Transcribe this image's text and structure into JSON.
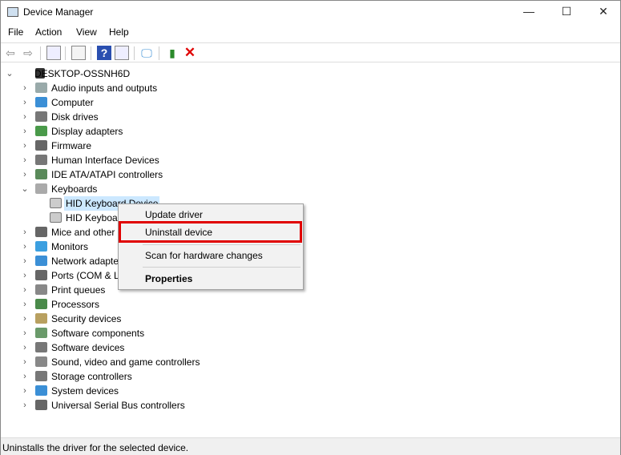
{
  "window": {
    "title": "Device Manager",
    "minimize": "—",
    "maximize": "☐",
    "close": "✕"
  },
  "menu": [
    "File",
    "Action",
    "View",
    "Help"
  ],
  "toolbar": {
    "icons": [
      "back-icon",
      "forward-icon",
      "show-hide-console-tree-icon",
      "properties-icon",
      "help-icon",
      "action-pane-icon",
      "scan-hardware-icon",
      "update-driver-icon",
      "uninstall-icon"
    ],
    "uninstall_color": "#e00000"
  },
  "tree": {
    "root": "DESKTOP-OSSNH6D",
    "items": [
      {
        "label": "Audio inputs and outputs",
        "icon": "speaker-icon",
        "color": "#9aa"
      },
      {
        "label": "Computer",
        "icon": "computer-icon",
        "color": "#3b8fd6"
      },
      {
        "label": "Disk drives",
        "icon": "disk-icon",
        "color": "#777"
      },
      {
        "label": "Display adapters",
        "icon": "display-adapter-icon",
        "color": "#4a9a4a"
      },
      {
        "label": "Firmware",
        "icon": "firmware-icon",
        "color": "#666"
      },
      {
        "label": "Human Interface Devices",
        "icon": "hid-icon",
        "color": "#777"
      },
      {
        "label": "IDE ATA/ATAPI controllers",
        "icon": "ide-icon",
        "color": "#5a8a5a"
      },
      {
        "label": "Keyboards",
        "icon": "keyboard-icon",
        "color": "#aaa",
        "expanded": true,
        "children": [
          {
            "label": "HID Keyboard Device",
            "selected": true
          },
          {
            "label": "HID Keyboard Device"
          }
        ]
      },
      {
        "label": "Mice and other pointing devices",
        "icon": "mouse-icon",
        "color": "#666"
      },
      {
        "label": "Monitors",
        "icon": "monitor-icon",
        "color": "#3b9fe0"
      },
      {
        "label": "Network adapters",
        "icon": "network-icon",
        "color": "#3b8fd6"
      },
      {
        "label": "Ports (COM & LPT)",
        "icon": "port-icon",
        "color": "#666"
      },
      {
        "label": "Print queues",
        "icon": "printer-icon",
        "color": "#888"
      },
      {
        "label": "Processors",
        "icon": "processor-icon",
        "color": "#4a8a4a"
      },
      {
        "label": "Security devices",
        "icon": "security-icon",
        "color": "#b8a060"
      },
      {
        "label": "Software components",
        "icon": "software-component-icon",
        "color": "#6a9a6a"
      },
      {
        "label": "Software devices",
        "icon": "software-device-icon",
        "color": "#777"
      },
      {
        "label": "Sound, video and game controllers",
        "icon": "sound-icon",
        "color": "#888"
      },
      {
        "label": "Storage controllers",
        "icon": "storage-icon",
        "color": "#777"
      },
      {
        "label": "System devices",
        "icon": "system-icon",
        "color": "#3b8fd6"
      },
      {
        "label": "Universal Serial Bus controllers",
        "icon": "usb-icon",
        "color": "#666"
      }
    ]
  },
  "context_menu": {
    "update": "Update driver",
    "uninstall": "Uninstall device",
    "scan": "Scan for hardware changes",
    "properties": "Properties",
    "highlight_color": "#e00000"
  },
  "status": "Uninstalls the driver for the selected device."
}
